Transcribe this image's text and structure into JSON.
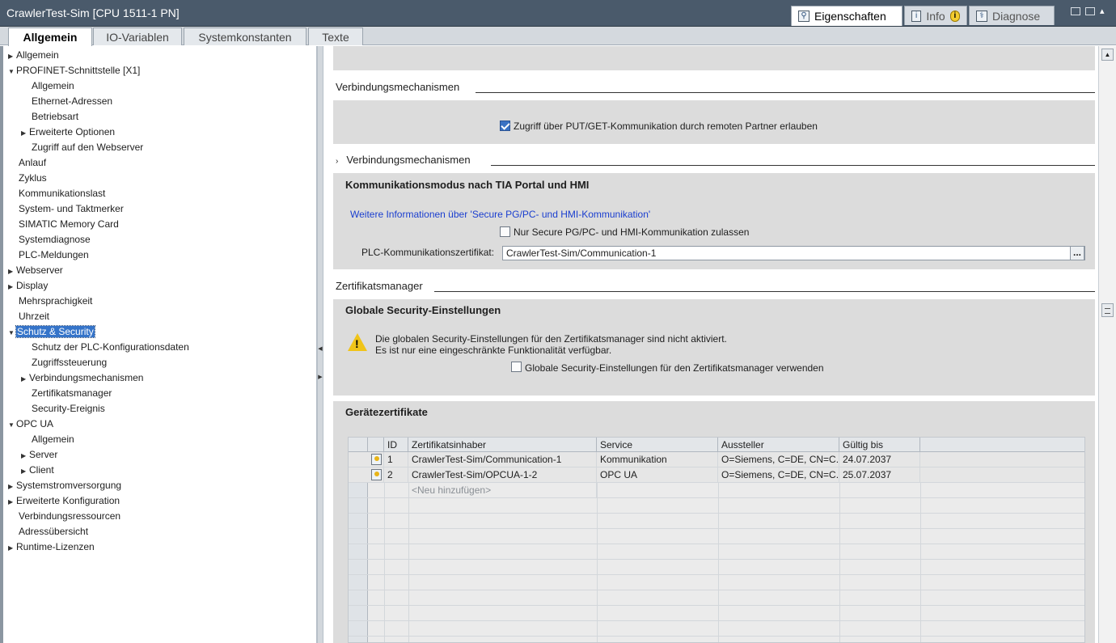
{
  "window": {
    "title": "CrawlerTest-Sim [CPU 1511-1 PN]",
    "right_tabs": [
      {
        "label": "Eigenschaften",
        "icon": "properties-icon"
      },
      {
        "label": "Info",
        "icon": "info-icon"
      },
      {
        "label": "Diagnose",
        "icon": "diagnostics-icon"
      }
    ]
  },
  "tabs": [
    "Allgemein",
    "IO-Variablen",
    "Systemkonstanten",
    "Texte"
  ],
  "tree": [
    {
      "label": "Allgemein"
    },
    {
      "label": "PROFINET-Schnittstelle [X1]"
    },
    {
      "label": "Allgemein"
    },
    {
      "label": "Ethernet-Adressen"
    },
    {
      "label": "Betriebsart"
    },
    {
      "label": "Erweiterte Optionen"
    },
    {
      "label": "Zugriff auf den Webserver"
    },
    {
      "label": "Anlauf"
    },
    {
      "label": "Zyklus"
    },
    {
      "label": "Kommunikationslast"
    },
    {
      "label": "System- und Taktmerker"
    },
    {
      "label": "SIMATIC Memory Card"
    },
    {
      "label": "Systemdiagnose"
    },
    {
      "label": "PLC-Meldungen"
    },
    {
      "label": "Webserver"
    },
    {
      "label": "Display"
    },
    {
      "label": "Mehrsprachigkeit"
    },
    {
      "label": "Uhrzeit"
    },
    {
      "label": "Schutz & Security"
    },
    {
      "label": "Schutz der PLC-Konfigurationsdaten"
    },
    {
      "label": "Zugriffssteuerung"
    },
    {
      "label": "Verbindungsmechanismen"
    },
    {
      "label": "Zertifikatsmanager"
    },
    {
      "label": "Security-Ereignis"
    },
    {
      "label": "OPC UA"
    },
    {
      "label": "Allgemein"
    },
    {
      "label": "Server"
    },
    {
      "label": "Client"
    },
    {
      "label": "Systemstromversorgung"
    },
    {
      "label": "Erweiterte Konfiguration"
    },
    {
      "label": "Verbindungsressourcen"
    },
    {
      "label": "Adressübersicht"
    },
    {
      "label": "Runtime-Lizenzen"
    }
  ],
  "content": {
    "sec1_title": "Verbindungsmechanismen",
    "putget_label": "Zugriff über PUT/GET-Kommunikation durch remoten Partner erlauben",
    "sec2_title": "Verbindungsmechanismen",
    "box2_title": "Kommunikationsmodus nach TIA Portal und HMI",
    "link_text": "Weitere Informationen über 'Secure PG/PC- und HMI-Kommunikation'",
    "secure_only_label": "Nur Secure PG/PC- und HMI-Kommunikation zulassen",
    "cert_label": "PLC-Kommunikationszertifikat:",
    "cert_value": "CrawlerTest-Sim/Communication-1",
    "browse_label": "...",
    "sec3_title": "Zertifikatsmanager",
    "box3_title": "Globale Security-Einstellungen",
    "warning_line1": "Die globalen Security-Einstellungen für den Zertifikatsmanager sind nicht aktiviert.",
    "warning_line2": "Es ist nur eine eingeschränkte Funktionalität verfügbar.",
    "global_sec_label": "Globale Security-Einstellungen für den Zertifikatsmanager verwenden",
    "box4_title": "Gerätezertifikate",
    "table": {
      "headers": [
        "ID",
        "Zertifikatsinhaber",
        "Service",
        "Aussteller",
        "Gültig bis"
      ],
      "rows": [
        {
          "id": "1",
          "owner": "CrawlerTest-Sim/Communication-1",
          "service": "Kommunikation",
          "issuer": "O=Siemens, C=DE, CN=C...",
          "valid": "24.07.2037"
        },
        {
          "id": "2",
          "owner": "CrawlerTest-Sim/OPCUA-1-2",
          "service": "OPC UA",
          "issuer": "O=Siemens, C=DE, CN=C...",
          "valid": "25.07.2037"
        }
      ],
      "add_placeholder": "<Neu hinzufügen>"
    }
  }
}
